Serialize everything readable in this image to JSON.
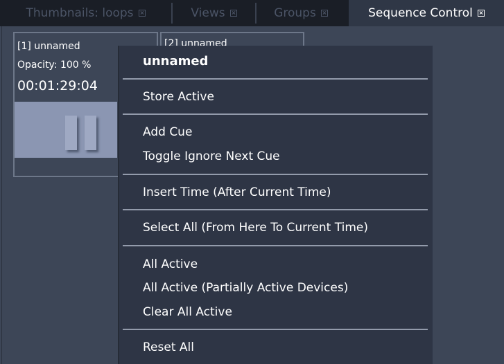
{
  "tabs": [
    {
      "label": "Thumbnails: loops"
    },
    {
      "label": "Views"
    },
    {
      "label": "Groups"
    },
    {
      "label": "Sequence Control"
    }
  ],
  "sequences": [
    {
      "title": "[1] unnamed",
      "opacity": "Opacity: 100 %",
      "timecode": "00:01:29:04"
    },
    {
      "title": "[2] unnamed"
    }
  ],
  "context_menu": {
    "header": "unnamed",
    "items": [
      {
        "label": "Store Active"
      },
      {
        "label": "Add Cue"
      },
      {
        "label": "Toggle Ignore Next Cue"
      },
      {
        "label": "Insert Time (After Current Time)"
      },
      {
        "label": "Select All (From Here To Current Time)"
      },
      {
        "label": "All Active"
      },
      {
        "label": "All Active (Partially Active Devices)"
      },
      {
        "label": "Clear All Active"
      },
      {
        "label": "Reset All"
      }
    ]
  },
  "icons": {
    "tab_close": "close-icon",
    "thumbnail_state": "pause-icon"
  },
  "colors": {
    "background": "#3d4657",
    "tab_bar": "#1a1e26",
    "active_tab": "#2f3746",
    "menu_background": "#2e3545",
    "thumbnail": "#8b96b2"
  }
}
